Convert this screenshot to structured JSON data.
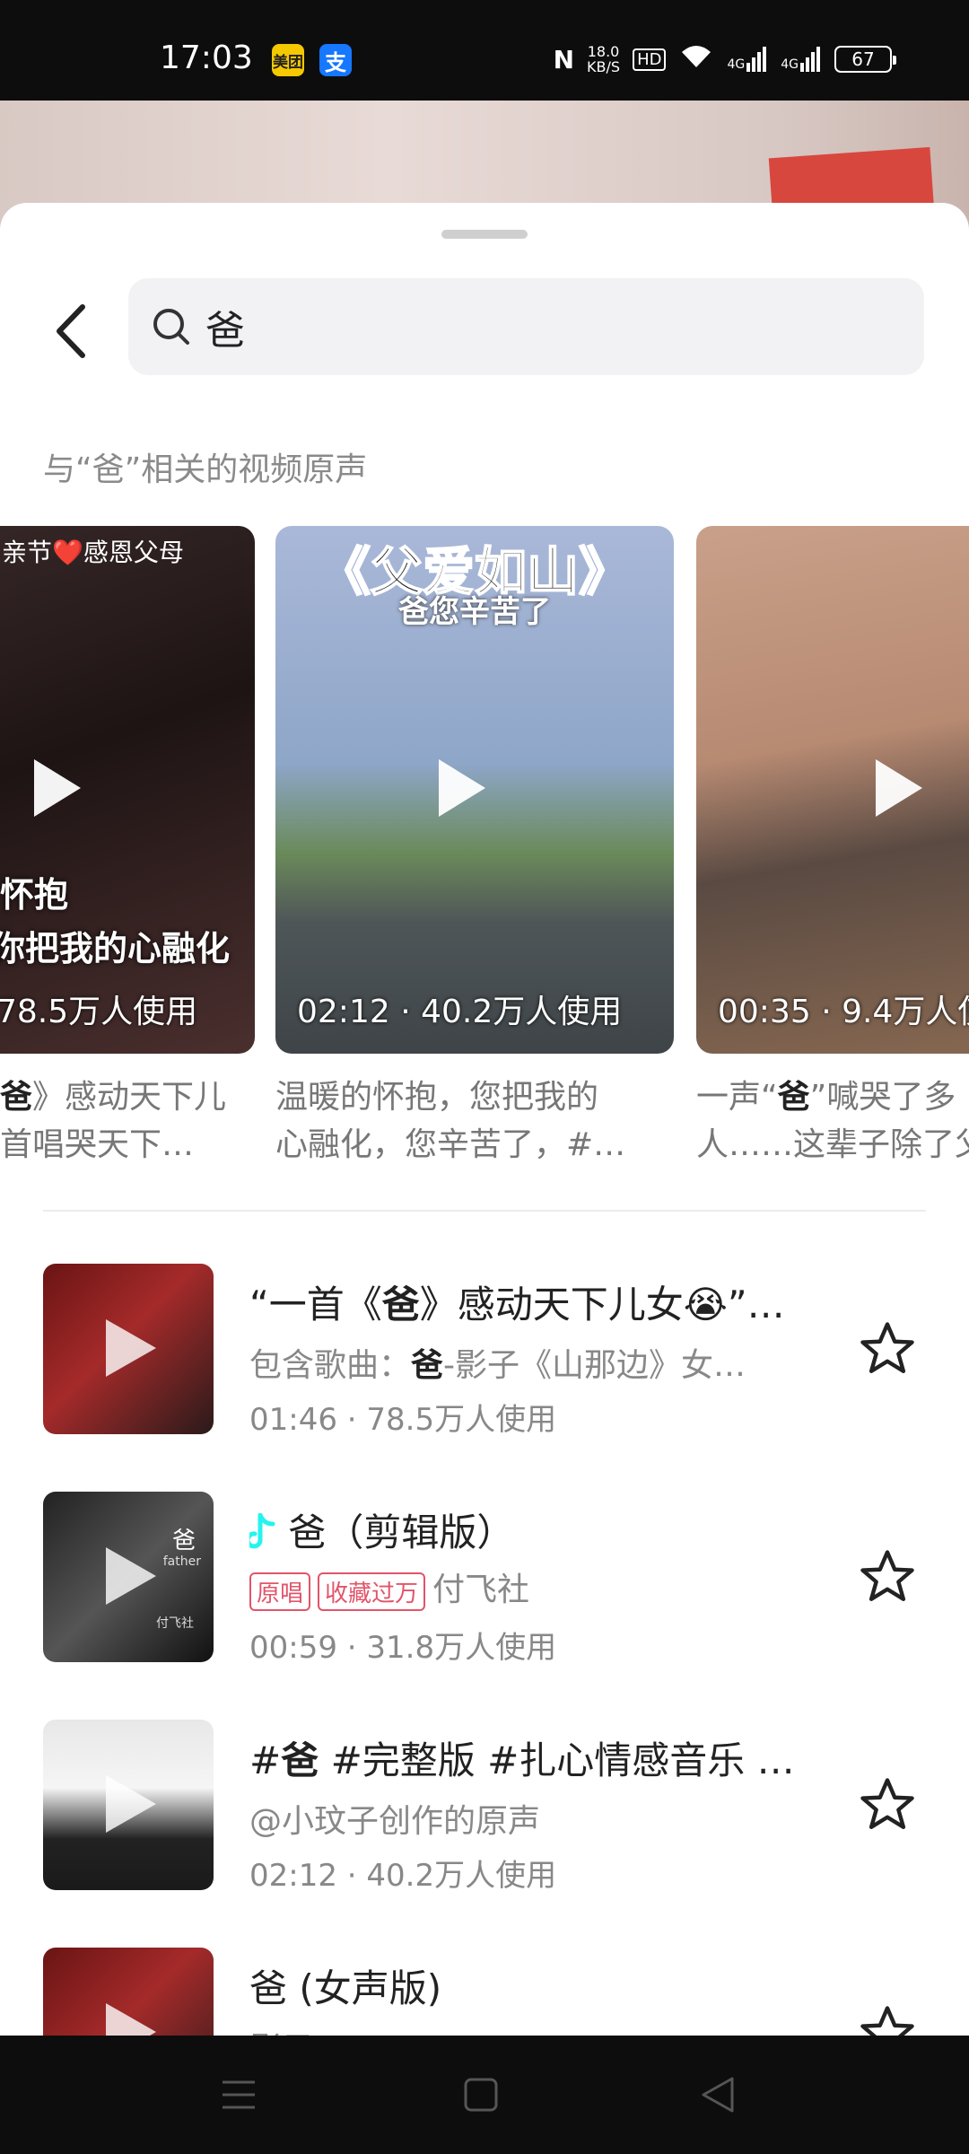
{
  "status_bar": {
    "time": "17:03",
    "app_icons": [
      "美团",
      "支"
    ],
    "net_speed_value": "18.0",
    "net_speed_unit": "KB/S",
    "hd": "HD",
    "signal1": "4G",
    "signal2": "4G",
    "battery": "67"
  },
  "search": {
    "query": "爸",
    "back_icon": "chevron-left-icon",
    "search_icon": "magnifier-icon"
  },
  "section_title": "与“爸”相关的视频原声",
  "cards": [
    {
      "overlay_top": "亲节❤️感恩父母",
      "overlay_line1": "怀抱",
      "overlay_line2": "你把我的心融化",
      "stats": "78.5万人使用",
      "desc_prefix": "",
      "desc_bold": "爸",
      "desc_rest": "》感动天下儿",
      "desc_line2": "首唱哭天下…"
    },
    {
      "overlay_title": "《父爱如山》",
      "overlay_subtitle": "爸您辛苦了",
      "stats": "02:12 · 40.2万人使用",
      "desc_line1": "温暖的怀抱，您把我的",
      "desc_line2": "心融化，您辛苦了，#…"
    },
    {
      "stats": "00:35 · 9.4万人使",
      "desc_prefix": "一声“",
      "desc_bold": "爸",
      "desc_rest": "”喊哭了多",
      "desc_line2": "人……这辈子除了父"
    }
  ],
  "list": [
    {
      "title_prefix": "“一首《",
      "title_bold": "爸",
      "title_rest": "》感动天下儿女😭”…",
      "sub_prefix": "包含歌曲：",
      "sub_bold": "爸",
      "sub_rest": "-影子《山那边》女…",
      "meta": "01:46 · 78.5万人使用"
    },
    {
      "title_icon": "music-note-icon",
      "title": "爸（剪辑版）",
      "tags": [
        "原唱",
        "收藏过万"
      ],
      "sub": "付飞社",
      "meta": "00:59 · 31.8万人使用",
      "cover_text_top": "爸",
      "cover_text_father": "father",
      "cover_text_bottom": "付飞社"
    },
    {
      "title_prefix": "#",
      "title_bold": "爸",
      "title_rest": " #完整版 #扎心情感音乐 …",
      "sub": "@小玟子创作的原声",
      "meta": "02:12 · 40.2万人使用"
    },
    {
      "title": "爸 (女声版)",
      "sub": "影子"
    }
  ],
  "colors": {
    "accent_tag": "#e2546a",
    "douyin_note": "#25f4ee"
  }
}
